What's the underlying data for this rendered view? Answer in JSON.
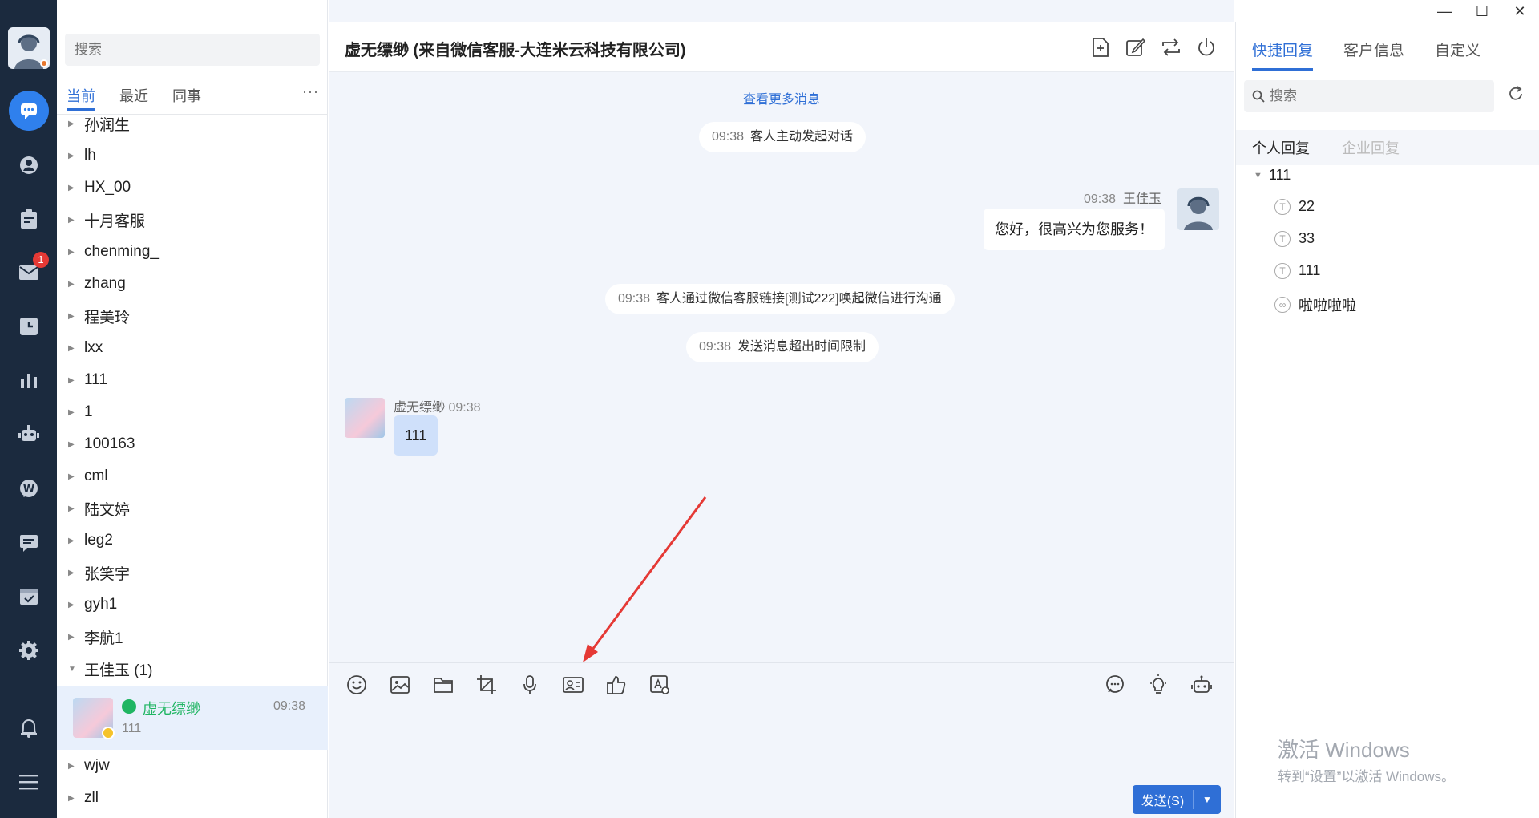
{
  "window": {
    "controls": {
      "minimize": "—",
      "maximize": "☐",
      "close": "✕"
    }
  },
  "nav": {
    "unread_badge": "1",
    "icons": [
      "chat-icon",
      "contact-icon",
      "clipboard-icon",
      "mail-icon",
      "history-icon",
      "stats-icon",
      "robot-icon",
      "weibo-icon",
      "message-icon",
      "calendar-icon",
      "settings-icon",
      "bell-icon",
      "menu-icon"
    ]
  },
  "contacts": {
    "search_placeholder": "搜索",
    "tabs": [
      "当前",
      "最近",
      "同事"
    ],
    "more": "···",
    "groups": [
      "孙润生",
      "lh",
      "HX_00",
      "十月客服",
      "chenming_",
      "zhang",
      "程美玲",
      "lxx",
      "111",
      "1",
      "100163",
      "cml",
      "陆文婷",
      "leg2",
      "张笑宇",
      "gyh1",
      "李航1",
      "王佳玉 (1)"
    ],
    "active_chat": {
      "name": "虚无缥缈",
      "time": "09:38",
      "preview": "111"
    },
    "groups_after": [
      "wjw",
      "zll"
    ]
  },
  "chat": {
    "title": "虚无缥缈 (来自微信客服-大连米云科技有限公司)",
    "view_more": "查看更多消息",
    "system_messages": [
      {
        "time": "09:38",
        "text": "客人主动发起对话"
      },
      {
        "time": "09:38",
        "text": "客人通过微信客服链接[测试222]唤起微信进行沟通"
      },
      {
        "time": "09:38",
        "text": "发送消息超出时间限制"
      }
    ],
    "agent_message": {
      "time": "09:38",
      "sender": "王佳玉",
      "text": "您好，很高兴为您服务！"
    },
    "customer_message": {
      "sender": "虚无缥缈",
      "time": "09:38",
      "text": "111"
    },
    "send_label": "发送(S)",
    "send_dropdown": "▼"
  },
  "right_panel": {
    "tabs": [
      "快捷回复",
      "客户信息",
      "自定义"
    ],
    "search_placeholder": "搜索",
    "subtabs": [
      "个人回复",
      "企业回复"
    ],
    "tree_root": "111",
    "items": [
      {
        "label": "22",
        "type": "T"
      },
      {
        "label": "33",
        "type": "T"
      },
      {
        "label": "111",
        "type": "T"
      },
      {
        "label": "啦啦啦啦",
        "type": "link"
      }
    ]
  },
  "watermark": {
    "line1": "激活 Windows",
    "line2": "转到“设置”以激活 Windows。"
  },
  "colors": {
    "accent": "#2f6fd6",
    "rail": "#1b2a3e",
    "wechat": "#1fb562",
    "annotation_arrow": "#e53935"
  }
}
